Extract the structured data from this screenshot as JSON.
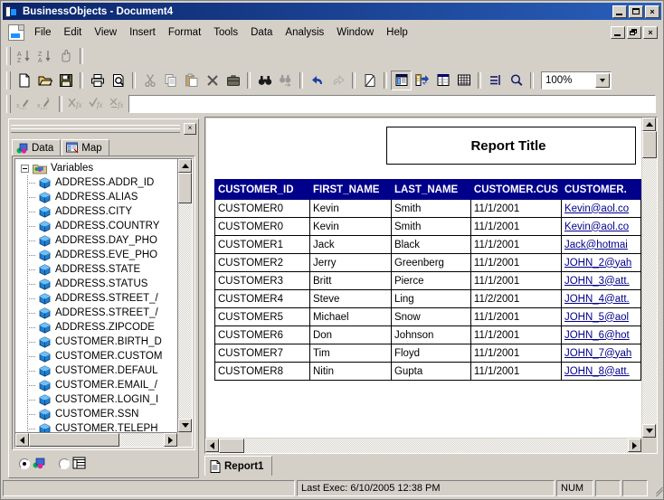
{
  "window": {
    "title": "BusinessObjects - Document4",
    "app_icon": "businessobjects-icon",
    "buttons": {
      "minimize": "_",
      "maximize": "□",
      "close": "×"
    }
  },
  "menubar": {
    "doc_icon": "document-icon",
    "items": [
      {
        "label": "File"
      },
      {
        "label": "Edit"
      },
      {
        "label": "View"
      },
      {
        "label": "Insert"
      },
      {
        "label": "Format"
      },
      {
        "label": "Tools"
      },
      {
        "label": "Data"
      },
      {
        "label": "Analysis"
      },
      {
        "label": "Window"
      },
      {
        "label": "Help"
      }
    ],
    "mdi_buttons": {
      "minimize": "_",
      "restore": "❐",
      "close": "×"
    }
  },
  "toolbars": {
    "sort_row": [
      {
        "name": "sort-ascending-button",
        "label": "Sort Ascending"
      },
      {
        "name": "sort-descending-button",
        "label": "Sort Descending"
      },
      {
        "name": "drill-hand-button",
        "label": "Drill"
      }
    ],
    "standard_row": [
      {
        "name": "new-document-button",
        "label": "New"
      },
      {
        "name": "open-document-button",
        "label": "Open"
      },
      {
        "name": "save-document-button",
        "label": "Save"
      },
      {
        "name": "print-button",
        "label": "Print"
      },
      {
        "name": "print-preview-button",
        "label": "Print Preview"
      },
      {
        "name": "cut-button",
        "label": "Cut"
      },
      {
        "name": "copy-button",
        "label": "Copy"
      },
      {
        "name": "paste-button",
        "label": "Paste"
      },
      {
        "name": "delete-button",
        "label": "Delete"
      },
      {
        "name": "briefcase-button",
        "label": "Send To"
      },
      {
        "name": "find-button",
        "label": "Find"
      },
      {
        "name": "find-next-button",
        "label": "Find Next"
      },
      {
        "name": "undo-button",
        "label": "Undo"
      },
      {
        "name": "redo-button",
        "label": "Redo"
      },
      {
        "name": "edit-data-provider-button",
        "label": "Edit Data Provider"
      },
      {
        "name": "view-report-button",
        "label": "View Report"
      },
      {
        "name": "slice-and-dice-button",
        "label": "Slice and Dice"
      },
      {
        "name": "insert-table-button",
        "label": "Insert Table"
      },
      {
        "name": "grid-button",
        "label": "Show Grid"
      },
      {
        "name": "insert-break-button",
        "label": "Insert Break"
      },
      {
        "name": "zoom-button",
        "label": "Zoom"
      }
    ],
    "zoom": {
      "value": "100%",
      "name": "zoom-combo"
    },
    "formula_row": [
      {
        "name": "insert-variable-button",
        "label": "Insert Variable"
      },
      {
        "name": "edit-variable-button",
        "label": "Edit Variable"
      },
      {
        "name": "cancel-formula-button",
        "label": "Cancel"
      },
      {
        "name": "accept-formula-button",
        "label": "Accept"
      },
      {
        "name": "formula-editor-button",
        "label": "Formula Editor"
      }
    ],
    "formula_input": {
      "value": "",
      "placeholder": ""
    }
  },
  "left_panel": {
    "close_label": "×",
    "tabs": [
      {
        "label": "Data",
        "icon": "data-icon",
        "active": true
      },
      {
        "label": "Map",
        "icon": "map-icon",
        "active": false
      }
    ],
    "tree": {
      "root": {
        "label": "Variables",
        "icon": "folder-icon",
        "expanded": true
      },
      "items": [
        "ADDRESS.ADDR_ID",
        "ADDRESS.ALIAS",
        "ADDRESS.CITY",
        "ADDRESS.COUNTRY",
        "ADDRESS.DAY_PHO",
        "ADDRESS.EVE_PHO",
        "ADDRESS.STATE",
        "ADDRESS.STATUS",
        "ADDRESS.STREET_/",
        "ADDRESS.STREET_/",
        "ADDRESS.ZIPCODE",
        "CUSTOMER.BIRTH_D",
        "CUSTOMER.CUSTOM",
        "CUSTOMER.DEFAUL",
        "CUSTOMER.EMAIL_/",
        "CUSTOMER.LOGIN_I",
        "CUSTOMER.SSN",
        "CUSTOMER.TELEPH"
      ]
    },
    "view_modes": [
      {
        "name": "data-view-radio",
        "icon": "data-icon",
        "selected": true
      },
      {
        "name": "structure-view-radio",
        "icon": "structure-icon",
        "selected": false
      }
    ]
  },
  "report": {
    "title": "Report Title",
    "table": {
      "columns": [
        "CUSTOMER_ID",
        "FIRST_NAME",
        "LAST_NAME",
        "CUSTOMER.CUS",
        "CUSTOMER."
      ],
      "rows": [
        [
          "CUSTOMER0",
          "Kevin",
          "Smith",
          "11/1/2001",
          "Kevin@aol.co"
        ],
        [
          "CUSTOMER0",
          "Kevin",
          "Smith",
          "11/1/2001",
          "Kevin@aol.co"
        ],
        [
          "CUSTOMER1",
          "Jack",
          "Black",
          "11/1/2001",
          "Jack@hotmai"
        ],
        [
          "CUSTOMER2",
          "Jerry",
          "Greenberg",
          "11/1/2001",
          "JOHN_2@yah"
        ],
        [
          "CUSTOMER3",
          "Britt",
          "Pierce",
          "11/1/2001",
          "JOHN_3@att."
        ],
        [
          "CUSTOMER4",
          "Steve",
          "Ling",
          "11/2/2001",
          "JOHN_4@att."
        ],
        [
          "CUSTOMER5",
          "Michael",
          "Snow",
          "11/1/2001",
          "JOHN_5@aol"
        ],
        [
          "CUSTOMER6",
          "Don",
          "Johnson",
          "11/1/2001",
          "JOHN_6@hot"
        ],
        [
          "CUSTOMER7",
          "Tim",
          "Floyd",
          "11/1/2001",
          "JOHN_7@yah"
        ],
        [
          "CUSTOMER8",
          "Nitin",
          "Gupta",
          "11/1/2001",
          "JOHN_8@att."
        ]
      ]
    },
    "tabs": [
      {
        "label": "Report1",
        "icon": "page-icon",
        "active": true
      }
    ]
  },
  "statusbar": {
    "message": "",
    "last_exec": "Last Exec: 6/10/2005  12:38 PM",
    "num_lock": "NUM",
    "pane1": "",
    "pane2": ""
  },
  "colors": {
    "titlebar_start": "#0a246a",
    "titlebar_end": "#2a5fba",
    "face": "#d4d0c8",
    "table_header_bg": "#00008b",
    "link": "#00008b"
  }
}
